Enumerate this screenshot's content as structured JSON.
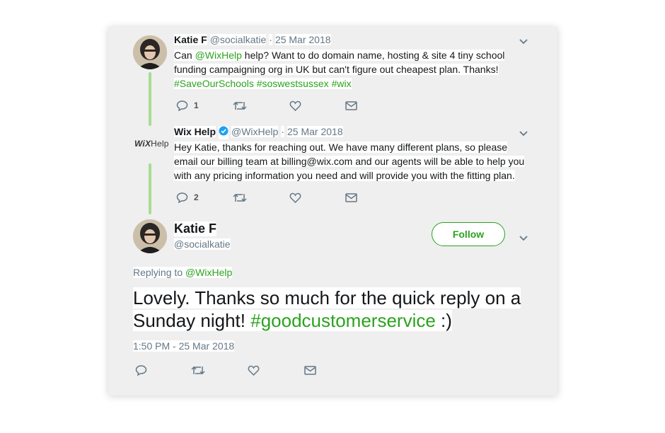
{
  "tweet1": {
    "name": "Katie F",
    "handle": "@socialkatie",
    "date": "25 Mar 2018",
    "text_before": "Can ",
    "mention": "@WixHelp",
    "text_after": " help? Want to do domain name, hosting & site 4 tiny school funding campaigning org in UK but can't figure out cheapest plan. Thanks!",
    "hashtags": [
      "#SaveOurSchools",
      "#soswestsussex",
      "#wix"
    ],
    "reply_count": "1"
  },
  "tweet2": {
    "logo_bold": "WiX",
    "logo_rest": "Help",
    "name": "Wix Help",
    "verified": "verified-badge-icon",
    "handle": "@WixHelp",
    "date": "25 Mar 2018",
    "text": "Hey Katie, thanks for reaching out. We have many different plans,  so please email our billing team at billing@wix.com and our agents will be able to help you with any pricing information you need and will provide you with the fitting plan.",
    "reply_count": "2"
  },
  "main": {
    "name": "Katie F",
    "handle": "@socialkatie",
    "follow_label": "Follow",
    "replying_label": "Replying to",
    "replying_mention": "@WixHelp",
    "text_before": "Lovely. Thanks so much for the quick reply on a Sunday night! ",
    "hashtag": "#goodcustomerservice",
    "text_after": "  :)",
    "timestamp": "1:50 PM - 25 Mar 2018"
  },
  "sep": "·",
  "colors": {
    "link": "#2aa31e",
    "thread_line": "#a8dc93",
    "card_bg": "#efefef",
    "muted": "#657786"
  }
}
